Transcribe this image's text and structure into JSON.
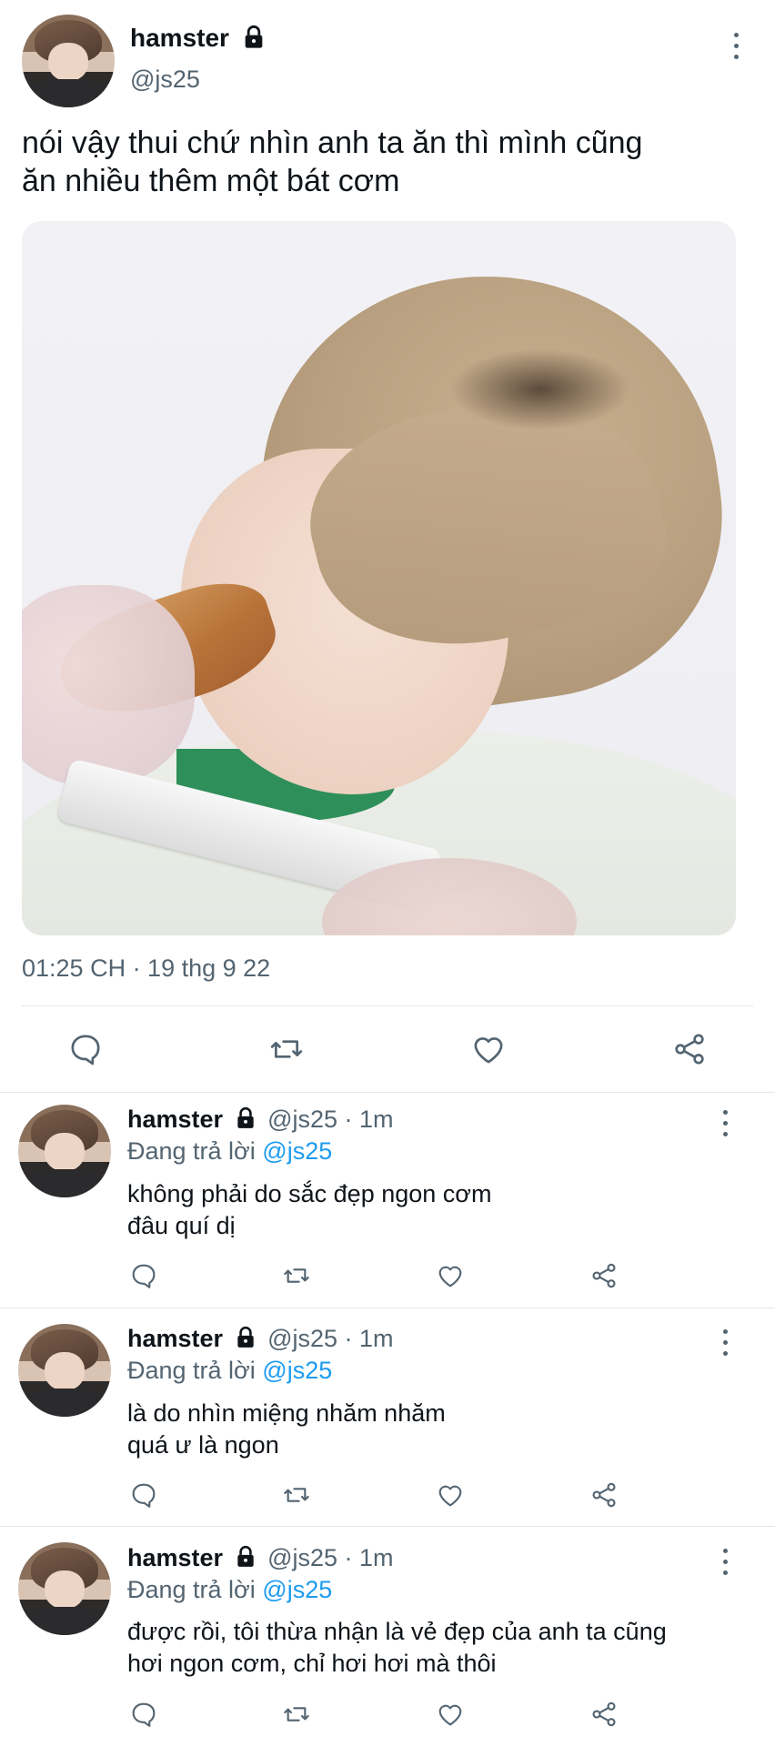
{
  "main_tweet": {
    "display_name": "hamster",
    "handle": "@js25",
    "text_line1": "nói vậy thui chứ nhìn anh ta ăn thì mình cũng",
    "text_line2": "ăn nhiều thêm một bát cơm",
    "timestamp": "01:25 CH · 19 thg 9 22",
    "actions": [
      "reply-icon",
      "retweet-icon",
      "like-icon",
      "share-icon"
    ]
  },
  "replies": [
    {
      "display_name": "hamster",
      "handle": "@js25",
      "time": "· 1m",
      "replying_prefix": "Đang trả lời",
      "replying_to": "@js25",
      "text_line1": "không phải do sắc đẹp ngon cơm",
      "text_line2": "đâu quí dị"
    },
    {
      "display_name": "hamster",
      "handle": "@js25",
      "time": "· 1m",
      "replying_prefix": "Đang trả lời",
      "replying_to": "@js25",
      "text_line1": "là do nhìn miệng nhăm nhăm",
      "text_line2": "quá ư là ngon"
    },
    {
      "display_name": "hamster",
      "handle": "@js25",
      "time": "· 1m",
      "replying_prefix": "Đang trả lời",
      "replying_to": "@js25",
      "text_line1": "được rồi, tôi thừa nhận là vẻ đẹp của anh ta cũng",
      "text_line2": "hơi ngon cơm, chỉ hơi hơi mà thôi"
    }
  ],
  "colors": {
    "text": "#0f1419",
    "secondary": "#536471",
    "link": "#1d9bf0",
    "divider": "#e5e7ea"
  }
}
